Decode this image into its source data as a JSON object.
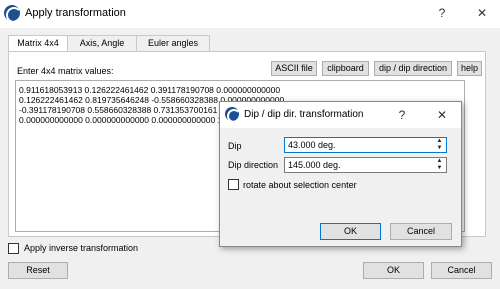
{
  "window": {
    "title": "Apply transformation",
    "help_glyph": "?",
    "close_glyph": "✕"
  },
  "tabs": [
    {
      "label": "Matrix 4x4",
      "active": true
    },
    {
      "label": "Axis, Angle",
      "active": false
    },
    {
      "label": "Euler angles",
      "active": false
    }
  ],
  "matrix_panel": {
    "label": "Enter 4x4 matrix values:",
    "buttons": {
      "ascii": "ASCII file",
      "clipboard": "clipboard",
      "dip": "dip / dip direction",
      "help": "help"
    },
    "rows": [
      "0.911618053913 0.126222461462 0.391178190708 0.000000000000",
      "0.126222461462 0.819735646248 -0.558660328388 0.000000000000",
      "-0.391178190708 0.558660328388 0.731353700161 0.000000000000",
      "0.000000000000 0.000000000000 0.000000000000 1.000000000000"
    ]
  },
  "inverse": {
    "label": "Apply inverse transformation",
    "checked": false
  },
  "footer": {
    "reset": "Reset",
    "ok": "OK",
    "cancel": "Cancel"
  },
  "dip_dialog": {
    "title": "Dip / dip dir. transformation",
    "help_glyph": "?",
    "close_glyph": "✕",
    "dip_label": "Dip",
    "dip_value": "43.000 deg.",
    "dipdir_label": "Dip direction",
    "dipdir_value": "145.000 deg.",
    "rotate_label": "rotate about selection center",
    "rotate_checked": false,
    "ok": "OK",
    "cancel": "Cancel"
  },
  "colors": {
    "brand": "#1d4f91",
    "focus_border": "#0078d7"
  }
}
